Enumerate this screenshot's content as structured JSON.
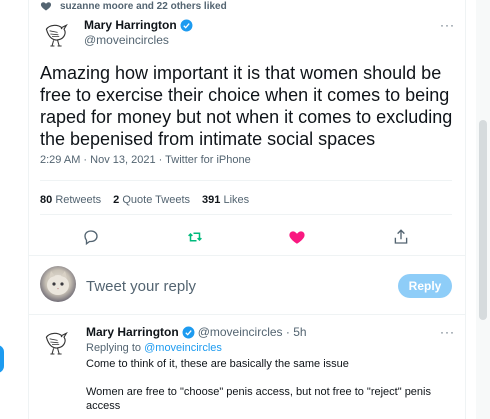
{
  "liked_by": "suzanne moore and 22 others liked",
  "tweet": {
    "author_name": "Mary Harrington",
    "author_handle": "@moveincircles",
    "text": "Amazing how important it is that women should be free to exercise their choice when it comes to being raped for money but not when it comes to excluding the bepenised from intimate social spaces",
    "timestamp": "2:29 AM · Nov 13, 2021 · Twitter for iPhone",
    "more_label": "···"
  },
  "stats": {
    "retweets_count": "80",
    "retweets_label": "Retweets",
    "quote_count": "2",
    "quote_label": "Quote Tweets",
    "likes_count": "391",
    "likes_label": "Likes"
  },
  "actions": {
    "reply_icon": "reply-icon",
    "retweet_icon": "retweet-icon",
    "like_icon": "heart-icon",
    "share_icon": "share-icon",
    "retweet_color": "#00ba7c",
    "like_color": "#f91880"
  },
  "composer": {
    "placeholder": "Tweet your reply",
    "button_label": "Reply"
  },
  "reply": {
    "author_name": "Mary Harrington",
    "author_handle": "@moveincircles · 5h",
    "replying_prefix": "Replying to",
    "replying_to": "@moveincircles",
    "more_label": "···",
    "lines": [
      "Come to think of it, these are basically the same issue",
      "Women are free to \"choose\" penis access, but not free to \"reject\" penis access"
    ]
  },
  "colors": {
    "accent": "#1d9bf0",
    "secondary_text": "#536471"
  }
}
